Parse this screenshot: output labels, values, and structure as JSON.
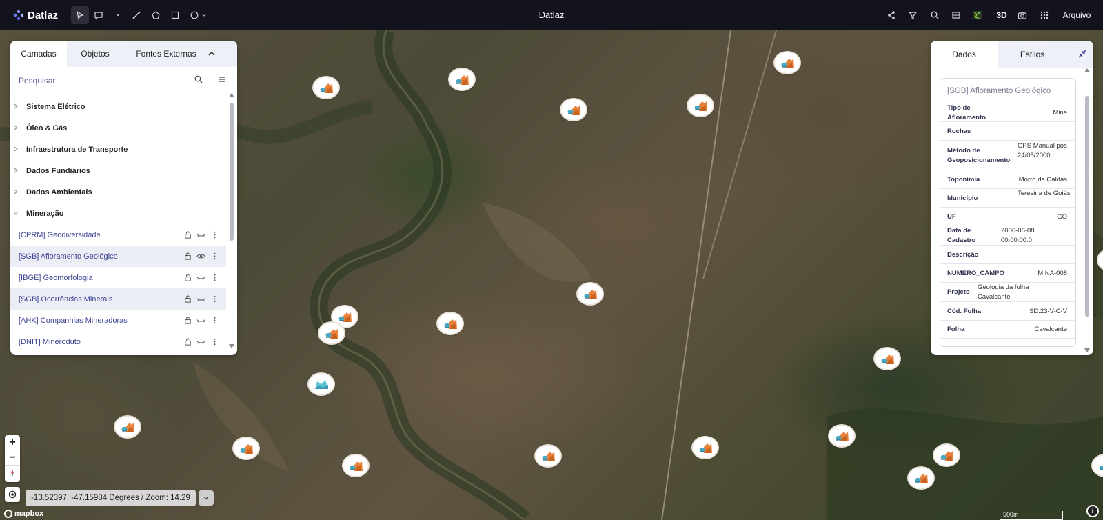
{
  "app": {
    "name": "Datlaz",
    "window_title": "Datlaz"
  },
  "toolbar": {
    "tools": [
      "select-pointer-icon",
      "comment-icon",
      "point-dot-icon",
      "line-icon",
      "polygon-icon",
      "rectangle-icon",
      "circle-icon"
    ],
    "right_actions": [
      "share-icon",
      "filter-icon",
      "search-icon",
      "table-icon",
      "satellite-layer-icon"
    ],
    "btn_3d": "3D",
    "camera": "camera-icon",
    "apps": "grid-apps-icon",
    "arquivo": "Arquivo"
  },
  "left_panel": {
    "tabs": [
      "Camadas",
      "Objetos",
      "Fontes Externas"
    ],
    "active_tab": "Camadas",
    "search_placeholder": "Pesquisar",
    "groups": [
      "Sistema Elétrico",
      "Óleo & Gás",
      "Infraestrutura de Transporte",
      "Dados Fundiários",
      "Dados Ambientais",
      "Mineração"
    ],
    "expanded_group": "Mineração",
    "layers": [
      {
        "label": "[CPRM] Geodiversidade",
        "visible": false,
        "selected": false
      },
      {
        "label": "[SGB] Afloramento Geológico",
        "visible": true,
        "selected": true
      },
      {
        "label": "[IBGE] Geomorfologia",
        "visible": false,
        "selected": false
      },
      {
        "label": "[SGB] Ocorrências Minerais",
        "visible": false,
        "selected": true
      },
      {
        "label": "[AHK] Companhias Mineradoras",
        "visible": false,
        "selected": false
      },
      {
        "label": "[DNIT] Mineroduto",
        "visible": false,
        "selected": false
      }
    ]
  },
  "right_panel": {
    "tabs": [
      "Dados",
      "Estilos"
    ],
    "active_tab": "Dados",
    "feature_title": "[SGB] Afloramento Geológico",
    "fields": [
      {
        "key": "Tipo de Afloramento",
        "value": "Mina"
      },
      {
        "key": "Rochas",
        "value": ""
      },
      {
        "key": "Método de Geoposicionamento",
        "value": "GPS Manual pós 24/05/2000"
      },
      {
        "key": "Toponímia",
        "value": "Morro de Caldas"
      },
      {
        "key": "Município",
        "value": "Teresina de Goiás"
      },
      {
        "key": "UF",
        "value": "GO"
      },
      {
        "key": "Data de Cadastro",
        "value": "2006-06-08 00:00:00.0"
      },
      {
        "key": "Descrição",
        "value": ""
      },
      {
        "key": "NUMERO_CAMPO",
        "value": "MINA-008"
      },
      {
        "key": "Projeto",
        "value": "Geologia da folha Cavalcante"
      },
      {
        "key": "Cód. Folha",
        "value": "SD.23-V-C-V"
      },
      {
        "key": "Folha",
        "value": "Cavalcante"
      }
    ]
  },
  "map": {
    "coordinates": "-13.52397, -47.15984 Degrees / Zoom: 14.29",
    "attribution": "mapbox",
    "scale": "500m",
    "zoom_in": "+",
    "zoom_out": "−",
    "pin_icon": "mine-outcrop-icon"
  },
  "colors": {
    "topbar": "#13131d",
    "accent": "#3f4593",
    "pin_orange": "#e8823a",
    "pin_teal": "#4aa7c2"
  }
}
